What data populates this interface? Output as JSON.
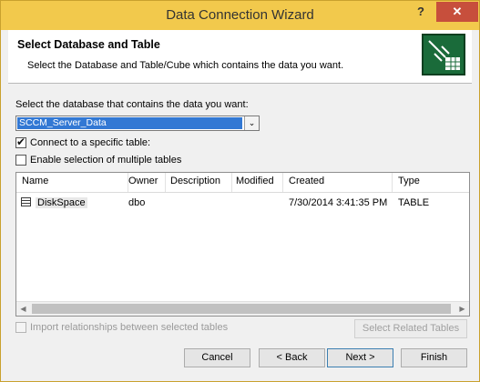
{
  "window": {
    "title": "Data Connection Wizard"
  },
  "titlebar": {
    "help_label": "?",
    "close_label": "✕"
  },
  "header": {
    "title": "Select Database and Table",
    "subtitle": "Select the Database and Table/Cube which contains the data you want."
  },
  "database": {
    "label": "Select the database that contains the data you want:",
    "selected": "SCCM_Server_Data",
    "arrow": "⌄"
  },
  "options": {
    "connect_specific_table": {
      "label": "Connect to a specific table:",
      "checked": true
    },
    "enable_multiple": {
      "label": "Enable selection of multiple tables",
      "checked": false
    }
  },
  "table": {
    "columns": [
      "Name",
      "Owner",
      "Description",
      "Modified",
      "Created",
      "Type"
    ],
    "rows": [
      {
        "name": "DiskSpace",
        "owner": "dbo",
        "description": "",
        "modified": "",
        "created": "7/30/2014 3:41:35 PM",
        "type": "TABLE"
      }
    ],
    "scroll_left": "◀",
    "scroll_right": "▶"
  },
  "import_relationships": {
    "label": "Import relationships between selected tables",
    "checked": false
  },
  "buttons": {
    "select_related": "Select Related Tables",
    "cancel": "Cancel",
    "back": "< Back",
    "next": "Next >",
    "finish": "Finish"
  }
}
